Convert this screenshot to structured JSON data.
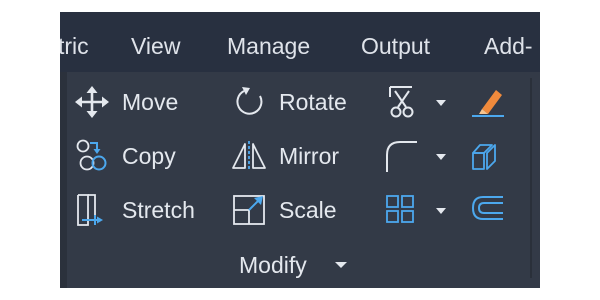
{
  "ribbon_tabs": [
    {
      "label": "tric"
    },
    {
      "label": "View"
    },
    {
      "label": "Manage"
    },
    {
      "label": "Output"
    },
    {
      "label": "Add-"
    }
  ],
  "modify_panel": {
    "tools": [
      {
        "label": "Move",
        "icon": "move-icon"
      },
      {
        "label": "Copy",
        "icon": "copy-icon"
      },
      {
        "label": "Stretch",
        "icon": "stretch-icon"
      },
      {
        "label": "Rotate",
        "icon": "rotate-icon"
      },
      {
        "label": "Mirror",
        "icon": "mirror-icon"
      },
      {
        "label": "Scale",
        "icon": "scale-icon"
      }
    ],
    "icon_only_tools": [
      {
        "icon": "trim-icon",
        "has_dropdown": true
      },
      {
        "icon": "fillet-icon",
        "has_dropdown": true
      },
      {
        "icon": "array-icon",
        "has_dropdown": true
      },
      {
        "icon": "erase-icon",
        "has_dropdown": false
      },
      {
        "icon": "explode-icon",
        "has_dropdown": false
      },
      {
        "icon": "offset-icon",
        "has_dropdown": false
      }
    ],
    "title": "Modify"
  },
  "colors": {
    "ribbon_bg": "#283040",
    "panel_bg": "#333a47",
    "text": "#e4e8ee",
    "accent_blue": "#4ca8ee",
    "accent_orange": "#f08a3c"
  }
}
